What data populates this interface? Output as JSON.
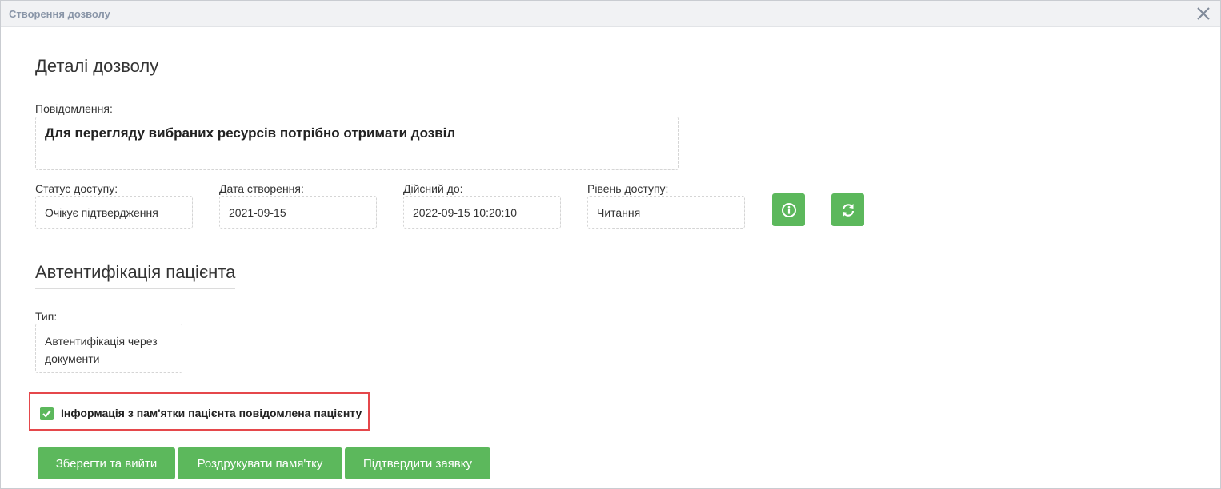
{
  "dialog": {
    "title": "Створення дозволу",
    "close_icon": "close-icon"
  },
  "details": {
    "heading": "Деталі дозволу",
    "message_label": "Повідомлення:",
    "message_value": "Для перегляду вибраних ресурсів потрібно отримати дозвіл",
    "status_label": "Статус доступу:",
    "status_value": "Очікує підтвердження",
    "created_label": "Дата створення:",
    "created_value": "2021-09-15",
    "valid_label": "Дійсний до:",
    "valid_value": "2022-09-15 10:20:10",
    "level_label": "Рівень доступу:",
    "level_value": "Читання",
    "info_icon": "info-icon",
    "refresh_icon": "refresh-icon"
  },
  "auth": {
    "heading": "Автентифікація пацієнта",
    "type_label": "Тип:",
    "type_value_line1": "Автентифікація через",
    "type_value_line2": "документи"
  },
  "consent": {
    "checked": true,
    "label": "Інформація з пам'ятки пацієнта повідомлена пацієнту"
  },
  "actions": {
    "save_exit": "Зберегти та вийти",
    "print_memo": "Роздрукувати памя'тку",
    "confirm_request": "Підтвердити заявку"
  },
  "colors": {
    "accent_green": "#5cb85c",
    "highlight_red": "#e5474b",
    "title_text": "#8a96a8"
  }
}
